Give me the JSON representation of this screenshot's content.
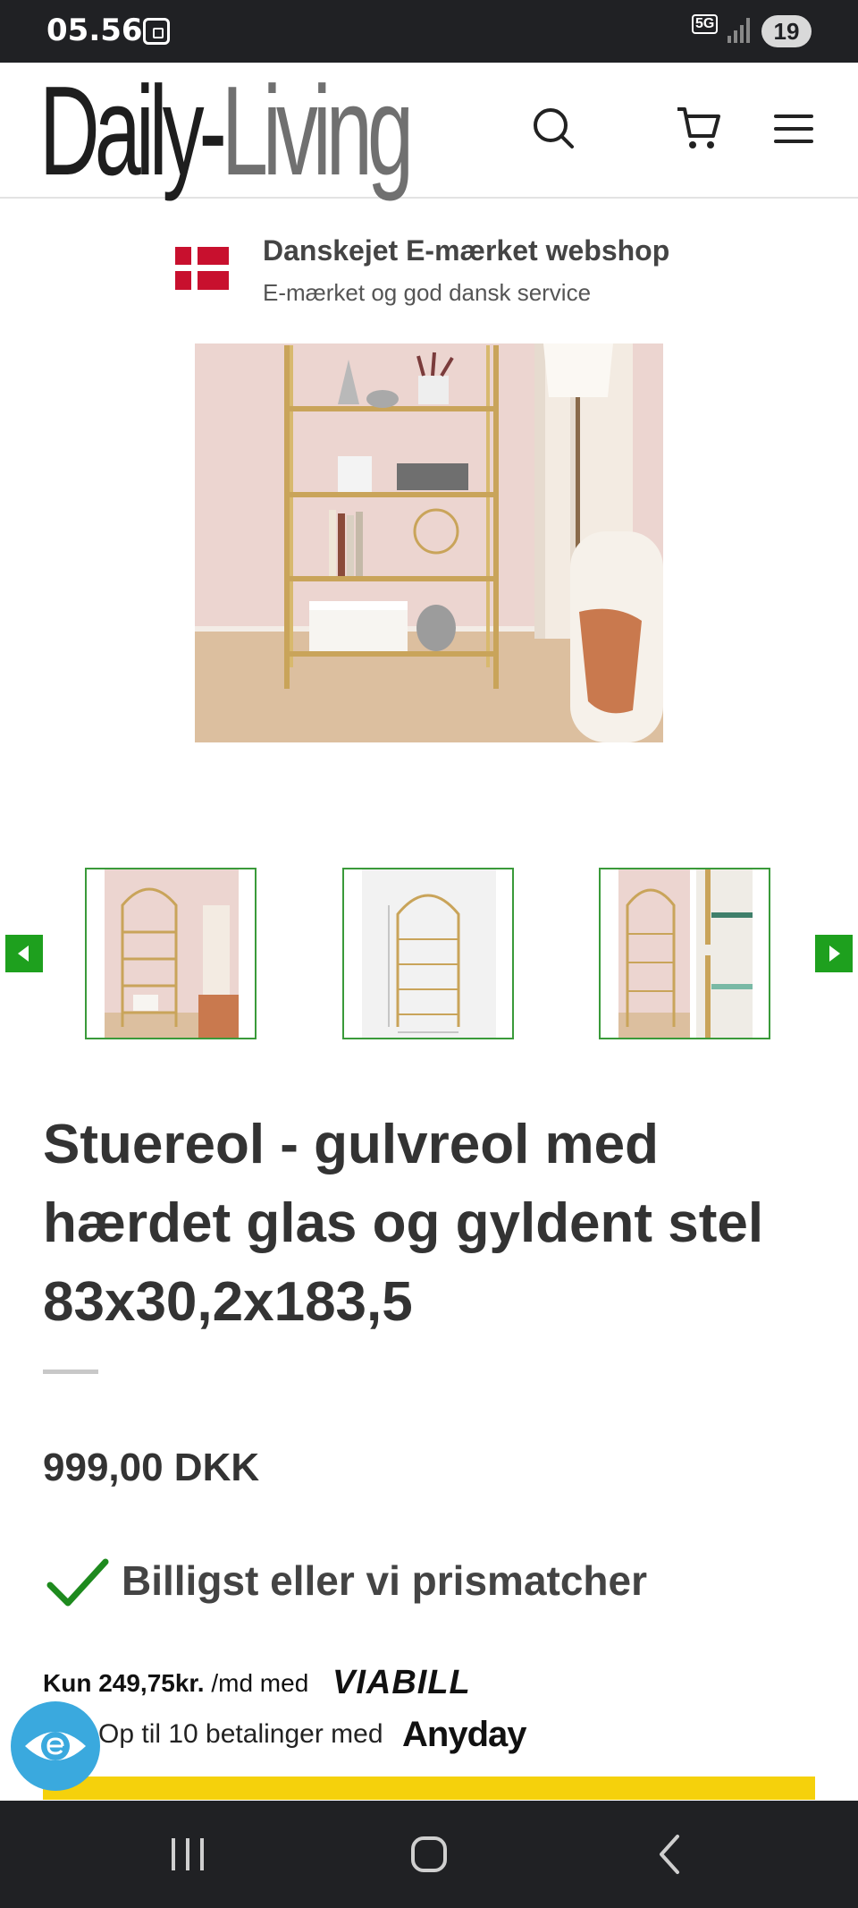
{
  "status_bar": {
    "time": "05.56",
    "network": "5G",
    "battery": "19"
  },
  "header": {
    "logo_part1": "Daily-",
    "logo_part2": "Living",
    "icons": [
      "search-icon",
      "cart-icon",
      "menu-icon"
    ]
  },
  "trust_badge": {
    "title": "Danskejet E-mærket webshop",
    "subtitle": "E-mærket og god dansk service"
  },
  "gallery": {
    "thumbnail_count": 3,
    "prev_icon": "chevron-left-icon",
    "next_icon": "chevron-right-icon"
  },
  "product": {
    "title": "Stuereol - gulvreol med hærdet glas og gyldent stel 83x30,2x183,5",
    "price": "999,00 DKK",
    "price_promise": "Billigst eller vi prismatcher"
  },
  "payment": {
    "viabill_prefix": "Kun 249,75kr.",
    "viabill_suffix": " /md med ",
    "viabill_logo": "VIABILL",
    "anyday_text": "Op til 10 betalinger med",
    "anyday_logo": "Anyday"
  },
  "colors": {
    "accent_green": "#1ea01e",
    "cta_yellow": "#f5d10c",
    "flag_red": "#c8102e",
    "a11y_blue": "#3aa9de"
  }
}
